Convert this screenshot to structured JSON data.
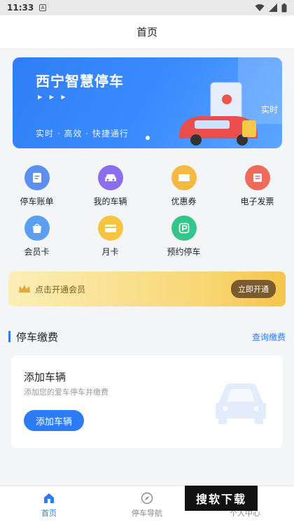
{
  "status_bar": {
    "time": "11:33",
    "notif_letter": "A"
  },
  "header": {
    "title": "首页"
  },
  "banner": {
    "title": "西宁智慧停车",
    "arrows": "▶ ▶ ▶",
    "subtitle": "实时 · 高效 · 快捷通行",
    "side_text": "实时"
  },
  "features": [
    {
      "label": "停车账单",
      "icon": "bill-icon",
      "color": "#5b8ff0"
    },
    {
      "label": "我的车辆",
      "icon": "car-icon",
      "color": "#8b6df0"
    },
    {
      "label": "优惠券",
      "icon": "coupon-icon",
      "color": "#f5b942"
    },
    {
      "label": "电子发票",
      "icon": "invoice-icon",
      "color": "#ee6b5b"
    },
    {
      "label": "会员卡",
      "icon": "member-card-icon",
      "color": "#5a9ff2"
    },
    {
      "label": "月卡",
      "icon": "monthly-card-icon",
      "color": "#f5c542"
    },
    {
      "label": "预约停车",
      "icon": "reserve-parking-icon",
      "color": "#35c48a"
    }
  ],
  "vip": {
    "text": "点击开通会员",
    "button": "立即开通"
  },
  "section": {
    "title": "停车缴费",
    "link": "查询缴费"
  },
  "add_card": {
    "title": "添加车辆",
    "subtitle": "添加您的爱车停车并缴费",
    "button": "添加车辆"
  },
  "tabs": [
    {
      "label": "首页",
      "icon": "home-icon",
      "active": true
    },
    {
      "label": "停车导航",
      "icon": "compass-icon",
      "active": false
    },
    {
      "label": "个人中心",
      "icon": "user-icon",
      "active": false
    }
  ],
  "watermark": "搜软下载",
  "colors": {
    "primary": "#2d7cf6",
    "vip_button": "#7b5a2e"
  }
}
